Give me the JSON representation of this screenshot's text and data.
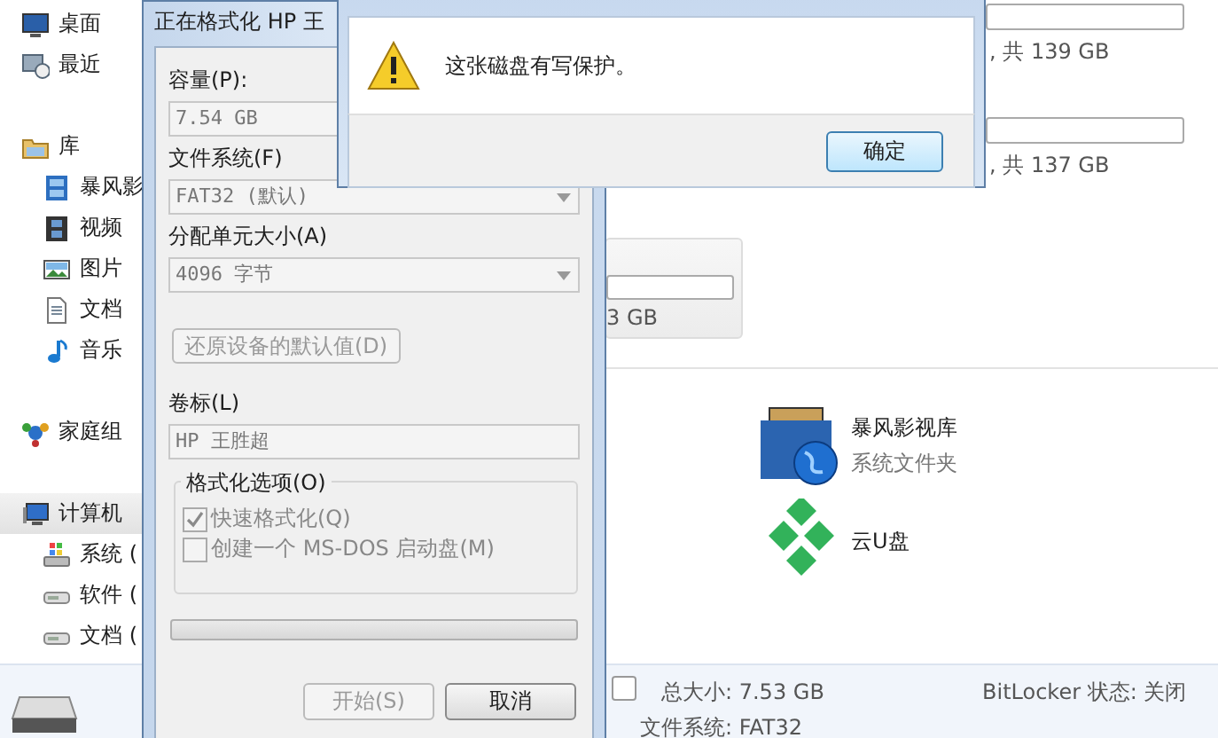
{
  "explorer": {
    "sidebar": {
      "items": [
        {
          "kind": "desktop",
          "label": "桌面",
          "selected": false
        },
        {
          "kind": "recent",
          "label": "最近",
          "selected": false
        },
        {
          "kind": "library",
          "label": "库",
          "selected": false,
          "children": [
            {
              "kind": "filmlib",
              "label": "暴风影",
              "selected": false
            },
            {
              "kind": "video",
              "label": "视频",
              "selected": false
            },
            {
              "kind": "picture",
              "label": "图片",
              "selected": false
            },
            {
              "kind": "document",
              "label": "文档",
              "selected": false
            },
            {
              "kind": "music",
              "label": "音乐",
              "selected": false
            }
          ]
        },
        {
          "kind": "homegroup",
          "label": "家庭组",
          "selected": false
        },
        {
          "kind": "computer",
          "label": "计算机",
          "selected": true,
          "children": [
            {
              "kind": "sysdrive",
              "label": "系统 (",
              "selected": false
            },
            {
              "kind": "drive",
              "label": "软件 (",
              "selected": false
            },
            {
              "kind": "drive",
              "label": "文档 (",
              "selected": false
            }
          ]
        }
      ]
    },
    "drives": [
      {
        "size": ", 共 139 GB"
      },
      {
        "size": ", 共 137 GB"
      }
    ],
    "tile": {
      "size": "3 GB"
    },
    "items": [
      {
        "kind": "library",
        "name": "暴风影视库",
        "subtitle": "系统文件夹"
      },
      {
        "kind": "cloud",
        "name": "云U盘"
      }
    ],
    "details": {
      "total": "总大小: 7.53 GB",
      "bitlocker": "BitLocker 状态: 关闭",
      "filesystem": "文件系统: FAT32"
    }
  },
  "format_dialog": {
    "title": "正在格式化 HP 王",
    "fields": [
      {
        "kind": "combo",
        "label": "容量(P):",
        "value": "7.54 GB"
      },
      {
        "kind": "combo",
        "label": "文件系统(F)",
        "value": "FAT32 (默认)"
      },
      {
        "kind": "combo",
        "label": "分配单元大小(A)",
        "value": "4096 字节"
      }
    ],
    "restore_button": {
      "label": "还原设备的默认值(D)",
      "disabled": true
    },
    "volume": {
      "label": "卷标(L)",
      "value": "HP 王胜超"
    },
    "options": {
      "title": "格式化选项(O)",
      "checkboxes": [
        {
          "label": "快速格式化(Q)",
          "checked": true,
          "disabled": true
        },
        {
          "label": "创建一个 MS-DOS 启动盘(M)",
          "checked": false,
          "disabled": true
        }
      ]
    },
    "progress": {
      "level": 0
    },
    "buttons": [
      {
        "label": "开始(S)",
        "disabled": true
      },
      {
        "label": "取消",
        "disabled": false
      }
    ]
  },
  "message_box": {
    "message": "这张磁盘有写保护。",
    "button": "确定"
  }
}
